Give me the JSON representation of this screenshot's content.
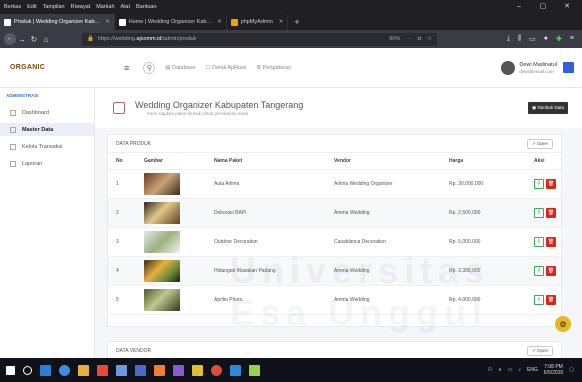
{
  "browser": {
    "menu": [
      "Berkas",
      "Edit",
      "Tampilan",
      "Riwayat",
      "Markah",
      "Alat",
      "Bantuan"
    ],
    "tabs": [
      {
        "label": "Produk | Wedding Organizer Kab...",
        "active": true
      },
      {
        "label": "Home | Wedding Organizer Kab...",
        "active": false
      },
      {
        "label": "phpMyAdmin",
        "active": false
      }
    ],
    "url_prefix": "https://wedding.",
    "url_host": "ajcomm.id",
    "url_path": "/admin/produk",
    "zoom": "90%",
    "win_controls": [
      "–",
      "▢",
      "✕"
    ]
  },
  "app": {
    "logo": "ORGANIC",
    "header_nav": [
      "Database",
      "Detail Aplikasi",
      "Pengaturan"
    ],
    "user_name": "Dewi Madinatul",
    "user_email": "dewi@email.com"
  },
  "sidebar": {
    "heading": "ADMINISTRASI",
    "items": [
      {
        "label": "Dashboard",
        "active": false
      },
      {
        "label": "Master Data",
        "active": true
      },
      {
        "label": "Kelola Transaksi",
        "active": false
      },
      {
        "label": "Laporan",
        "active": false
      }
    ]
  },
  "page": {
    "title": "Wedding Organizer Kabupaten Tangerang",
    "subtitle": "Kami siapkan paket terbaik untuk pernikahan anda",
    "add_button": "Tambah Data"
  },
  "produk": {
    "title": "DATA PRODUK",
    "open_label": "Open",
    "columns": [
      "No",
      "Gambar",
      "Nama Paket",
      "Vendor",
      "Harga",
      "Aksi"
    ],
    "rows": [
      {
        "no": "1",
        "nama": "Aula Arlima",
        "vendor": "Arlima Wedding Organizer",
        "harga": "Rp. 30,000,000"
      },
      {
        "no": "2",
        "nama": "Dekorasi BAPI",
        "vendor": "Amma Wedding",
        "harga": "Rp. 2,500,000"
      },
      {
        "no": "3",
        "nama": "Outdoor Decoration",
        "vendor": "Casablanca Decoration",
        "harga": "Rp. 5,000,000"
      },
      {
        "no": "4",
        "nama": "Hidangan Masakan Padang",
        "vendor": "Amma Wedding",
        "harga": "Rp. 3,300,000"
      },
      {
        "no": "5",
        "nama": "Aprilio Photo",
        "vendor": "Amma Wedding",
        "harga": "Rp. 4,000,000"
      }
    ]
  },
  "vendor": {
    "title": "DATA VENDOR",
    "open_label": "Open"
  },
  "taskbar": {
    "lang": "ENG",
    "time": "7:08 PM",
    "date": "6/5/2020"
  },
  "watermark": "Universitas Esa Unggul"
}
